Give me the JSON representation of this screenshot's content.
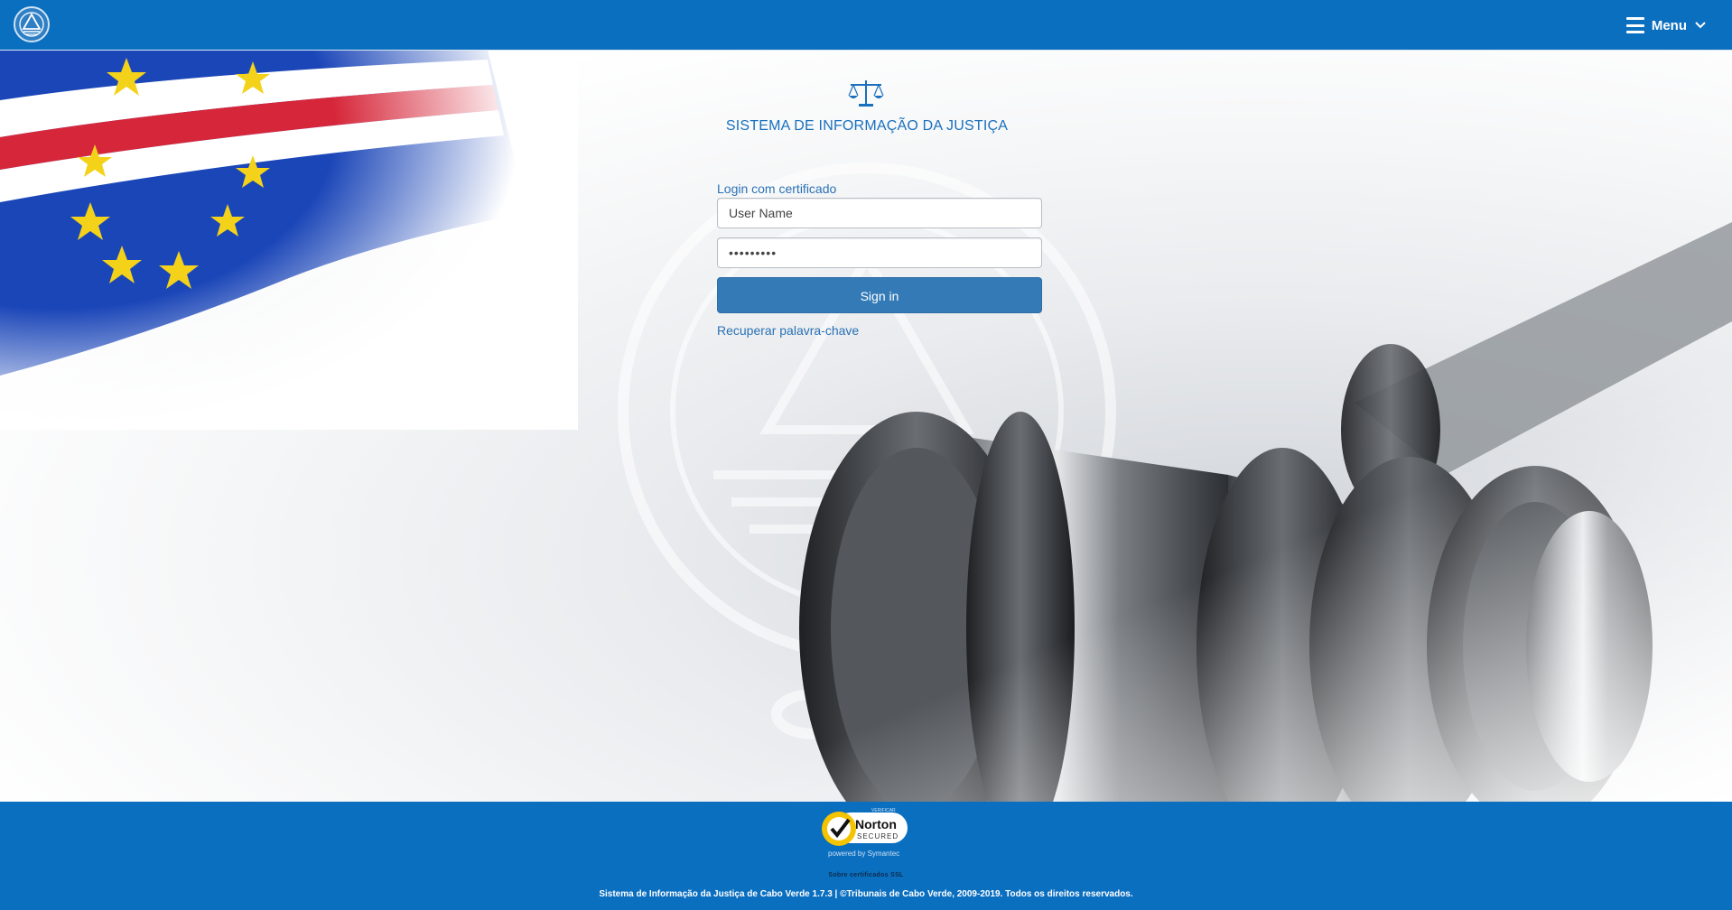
{
  "header": {
    "menu_label": "Menu",
    "colors": {
      "bar": "#0b6fc0"
    }
  },
  "brand": {
    "title": "SISTEMA DE INFORMAÇÃO DA JUSTIÇA",
    "icon": "scales-of-justice-icon"
  },
  "login": {
    "certificate_link": "Login com certificado",
    "username_value": "User Name",
    "password_value": "•••••••••",
    "signin_label": "Sign in",
    "recover_link": "Recuperar palavra-chave",
    "colors": {
      "button": "#337ab7",
      "link": "#2a72b5"
    }
  },
  "footer": {
    "norton_verify": "VERIFICAR",
    "norton_name": "Norton",
    "norton_secured": "SECURED",
    "norton_powered": "powered by Symantec",
    "ssl_link": "Sobre certificados SSL",
    "copyright": "Sistema de Informação da Justiça de Cabo Verde 1.7.3 | ©Tribunais de Cabo Verde, 2009-2019. Todos os direitos reservados."
  }
}
